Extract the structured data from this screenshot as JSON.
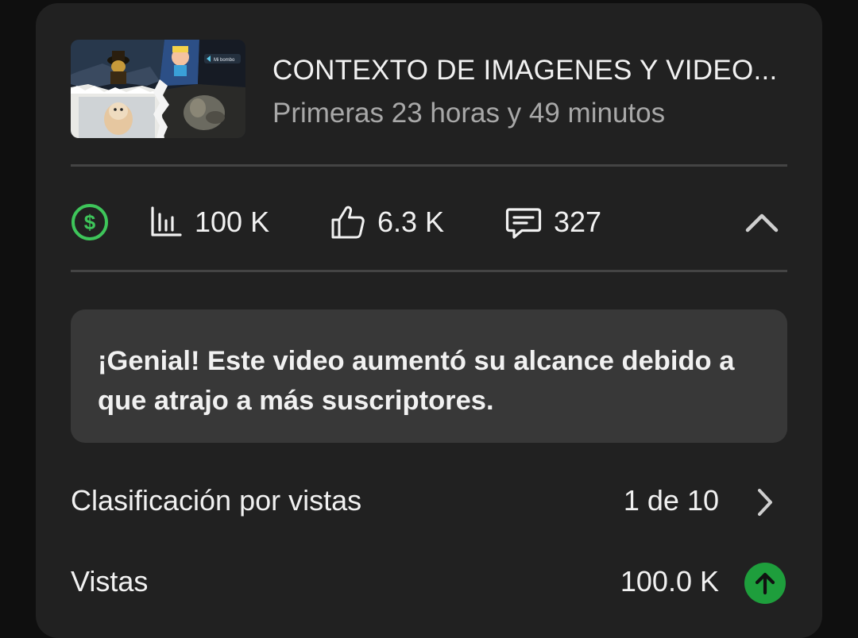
{
  "video": {
    "title": "CONTEXTO DE IMAGENES Y VIDEO...",
    "subtitle": "Primeras 23 horas y 49 minutos",
    "thumbnail_icon": "video-thumbnail-collage",
    "thumbnail_inset_text": "Mi bombo"
  },
  "stats": {
    "monetization_icon": "dollar-circle-icon",
    "monetization_color": "#3ec55a",
    "views_icon": "bar-chart-icon",
    "views": "100 K",
    "likes_icon": "thumbs-up-icon",
    "likes": "6.3 K",
    "comments_icon": "comment-icon",
    "comments": "327",
    "collapse_icon": "chevron-up-icon"
  },
  "callout": {
    "text": "¡Genial! Este video aumentó su alcance debido a que atrajo a más suscriptores."
  },
  "metrics": [
    {
      "label": "Clasificación por vistas",
      "value": "1 de 10",
      "icon": "chevron-right-icon"
    },
    {
      "label": "Vistas",
      "value": "100.0 K",
      "icon": "arrow-up-circle-icon",
      "icon_color": "#1e9e3c"
    }
  ]
}
